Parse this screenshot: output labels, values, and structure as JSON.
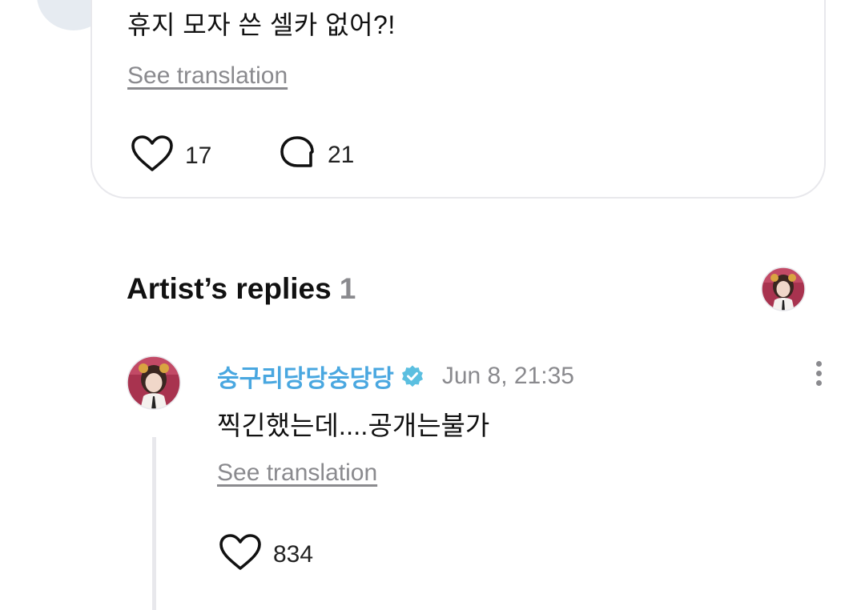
{
  "fan_post": {
    "text": "휴지 모자 쓴 셀카 없어?!",
    "see_translation": "See translation",
    "like_count": "17",
    "comment_count": "21"
  },
  "artist_replies": {
    "title": "Artist’s replies",
    "count": "1"
  },
  "reply": {
    "author": "숭구리당당숭당당",
    "timestamp": "Jun 8, 21:35",
    "text": "찍긴했는데....공개는불가",
    "see_translation": "See translation",
    "like_count": "834"
  },
  "icons": {
    "like": "heart-outline-icon",
    "comment": "speech-bubble-icon",
    "verified": "verified-badge-icon",
    "more": "more-vertical-icon"
  },
  "colors": {
    "artist_name": "#49a7e0",
    "verified_badge": "#5bbfe0",
    "muted_text": "#8a8a8e",
    "card_border": "#e8e8ec"
  }
}
